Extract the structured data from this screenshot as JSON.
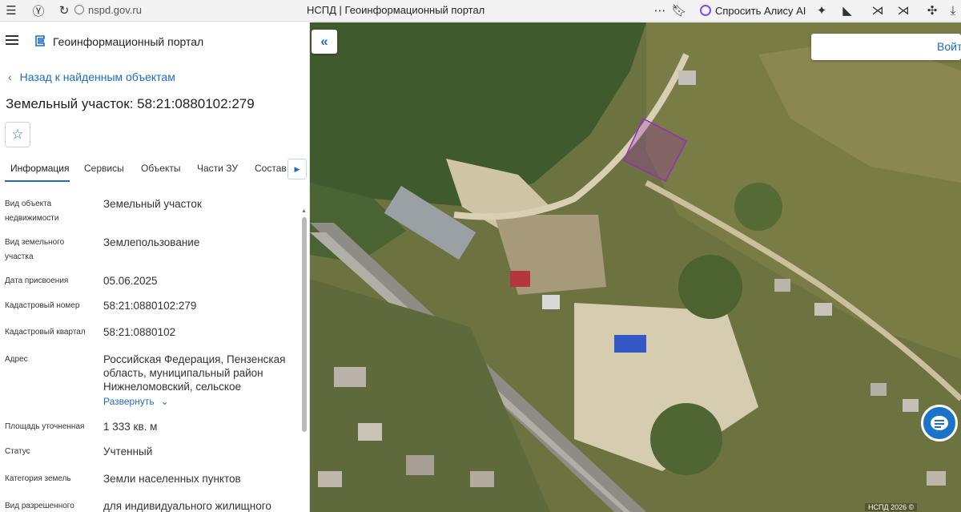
{
  "browser": {
    "url": "nspd.gov.ru",
    "tab_title": "НСПД | Геоинформационный портал",
    "alisa_label": "Спросить Алису AI"
  },
  "header": {
    "brand": "Геоинформационный портал"
  },
  "nav": {
    "back_label": "Назад к найденным объектам"
  },
  "object": {
    "title": "Земельный участок: 58:21:0880102:279"
  },
  "tabs": [
    {
      "label": "Информация",
      "active": true
    },
    {
      "label": "Сервисы",
      "active": false
    },
    {
      "label": "Объекты",
      "active": false
    },
    {
      "label": "Части ЗУ",
      "active": false
    },
    {
      "label": "Состав",
      "active": false
    }
  ],
  "info": {
    "rows": [
      {
        "label": "Вид объекта недвижимости",
        "value": "Земельный участок"
      },
      {
        "label": "Вид земельного участка",
        "value": "Землепользование"
      },
      {
        "label": "Дата присвоения",
        "value": "05.06.2025"
      },
      {
        "label": "Кадастровый номер",
        "value": "58:21:0880102:279"
      },
      {
        "label": "Кадастровый квартал",
        "value": "58:21:0880102"
      },
      {
        "label": "Адрес",
        "value": "Российская Федерация, Пензенская область, муниципальный район Нижнеломовский, сельское"
      },
      {
        "label": "Площадь уточненная",
        "value": "1 333 кв. м"
      },
      {
        "label": "Статус",
        "value": "Учтенный"
      },
      {
        "label": "Категория земель",
        "value": "Земли населенных пунктов"
      },
      {
        "label": "Вид разрешенного",
        "value": "для индивидуального жилищного"
      }
    ],
    "expand_label": "Развернуть"
  },
  "map": {
    "login_label": "Войт",
    "copyright": "НСПД 2026 ©"
  },
  "colors": {
    "accent": "#1a6cc4",
    "parcel_outline": "#9b2bbf"
  }
}
